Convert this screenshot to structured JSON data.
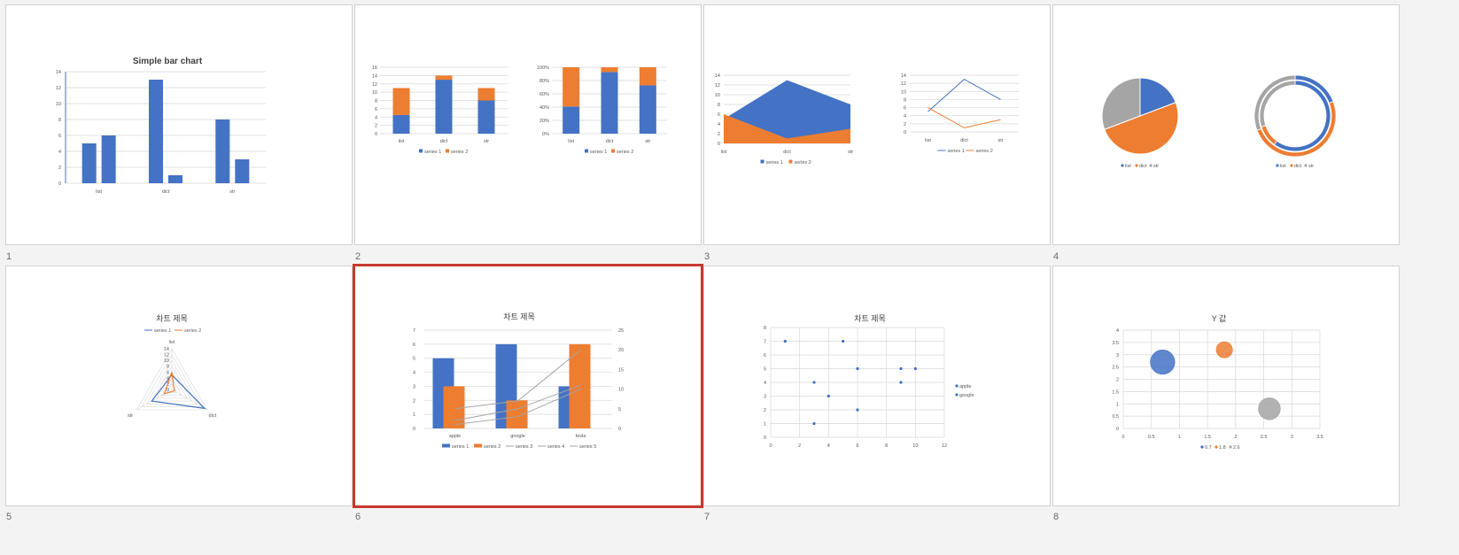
{
  "colors": {
    "blue": "#4472c4",
    "orange": "#ed7d31",
    "gray": "#a5a5a5",
    "selection": "#c8382e"
  },
  "slides": [
    {
      "number": "1",
      "chart_data": {
        "type": "bar",
        "title": "Simple bar chart",
        "categories": [
          "list",
          "dict",
          "str"
        ],
        "series": [
          {
            "values": [
              5,
              13,
              8
            ]
          },
          {
            "values": [
              6,
              1,
              3
            ]
          }
        ],
        "ylim": [
          0,
          14
        ],
        "yticks": [
          "0",
          "2",
          "4",
          "6",
          "8",
          "10",
          "12",
          "14"
        ]
      }
    },
    {
      "number": "2",
      "chart_data": [
        {
          "type": "bar",
          "stacked": true,
          "categories": [
            "list",
            "dict",
            "str"
          ],
          "series": [
            {
              "name": "series 1",
              "values": [
                4.5,
                13,
                8
              ]
            },
            {
              "name": "series 2",
              "values": [
                6.5,
                1,
                3
              ]
            }
          ],
          "ylim": [
            0,
            16
          ],
          "yticks": [
            "0",
            "2",
            "4",
            "6",
            "8",
            "10",
            "12",
            "14",
            "16"
          ]
        },
        {
          "type": "bar",
          "stacked": "percent",
          "categories": [
            "list",
            "dict",
            "str"
          ],
          "series": [
            {
              "name": "series 1",
              "values": [
                4.5,
                13,
                8
              ]
            },
            {
              "name": "series 2",
              "values": [
                6.5,
                1,
                3
              ]
            }
          ],
          "ylim": [
            0,
            100
          ],
          "yticks": [
            "0%",
            "20%",
            "40%",
            "60%",
            "80%",
            "100%"
          ]
        }
      ]
    },
    {
      "number": "3",
      "chart_data": [
        {
          "type": "area",
          "categories": [
            "list",
            "dict",
            "str"
          ],
          "series": [
            {
              "name": "series 1",
              "values": [
                5,
                13,
                8
              ]
            },
            {
              "name": "series 2",
              "values": [
                6,
                1,
                3
              ]
            }
          ],
          "ylim": [
            0,
            14
          ],
          "yticks": [
            "0",
            "2",
            "4",
            "6",
            "8",
            "10",
            "12",
            "14"
          ]
        },
        {
          "type": "line",
          "categories": [
            "list",
            "dict",
            "str"
          ],
          "series": [
            {
              "name": "series 1",
              "values": [
                5,
                13,
                8
              ]
            },
            {
              "name": "series 2",
              "values": [
                6,
                1,
                3
              ]
            }
          ],
          "ylim": [
            0,
            14
          ],
          "yticks": [
            "0",
            "2",
            "4",
            "6",
            "8",
            "10",
            "12",
            "14"
          ]
        }
      ]
    },
    {
      "number": "4",
      "chart_data": [
        {
          "type": "pie",
          "categories": [
            "list",
            "dict",
            "str"
          ],
          "values": [
            5,
            13,
            8
          ]
        },
        {
          "type": "pie",
          "donut": true,
          "categories": [
            "list",
            "dict",
            "str"
          ],
          "series": [
            {
              "values": [
                5,
                13,
                8
              ]
            },
            {
              "values": [
                6,
                1,
                3
              ]
            }
          ]
        }
      ]
    },
    {
      "number": "5",
      "chart_data": {
        "type": "radar",
        "title": "차트 제목",
        "categories": [
          "list",
          "dict",
          "str"
        ],
        "series": [
          {
            "name": "series 1",
            "values": [
              5,
              13,
              8
            ]
          },
          {
            "name": "series 2",
            "values": [
              6,
              1,
              3
            ]
          }
        ],
        "ylim": [
          0,
          14
        ],
        "rticks": [
          "0",
          "2",
          "4",
          "6",
          "8",
          "10",
          "12",
          "14"
        ]
      }
    },
    {
      "number": "6",
      "selected": true,
      "chart_data": {
        "type": "bar",
        "title": "차트 제목",
        "categories": [
          "apple",
          "google",
          "tesla"
        ],
        "series": [
          {
            "name": "series 1",
            "type": "bar",
            "axis": "left",
            "values": [
              5,
              6,
              3
            ]
          },
          {
            "name": "series 2",
            "type": "bar",
            "axis": "left",
            "values": [
              3,
              2,
              6
            ]
          },
          {
            "name": "series 3",
            "type": "line",
            "axis": "right",
            "values": [
              5,
              7,
              20
            ]
          },
          {
            "name": "series 4",
            "type": "line",
            "axis": "right",
            "values": [
              2,
              5,
              11
            ]
          },
          {
            "name": "series 5",
            "type": "line",
            "axis": "right",
            "values": [
              1,
              3,
              10
            ]
          }
        ],
        "ylim": [
          0,
          7
        ],
        "yticks": [
          "0",
          "1",
          "2",
          "3",
          "4",
          "5",
          "6",
          "7"
        ],
        "y2lim": [
          0,
          25
        ],
        "y2ticks": [
          "0",
          "5",
          "10",
          "15",
          "20",
          "25"
        ]
      }
    },
    {
      "number": "7",
      "chart_data": {
        "type": "scatter",
        "title": "차트 제목",
        "series": [
          {
            "name": "apple",
            "points": [
              [
                1,
                7
              ],
              [
                5,
                7
              ],
              [
                6,
                5
              ],
              [
                9,
                5
              ],
              [
                10,
                5
              ],
              [
                3,
                4
              ],
              [
                9,
                4
              ],
              [
                4,
                3
              ],
              [
                6,
                2
              ],
              [
                3,
                1
              ]
            ]
          },
          {
            "name": "google",
            "points": []
          }
        ],
        "xlim": [
          0,
          12
        ],
        "ylim": [
          0,
          8
        ],
        "xticks": [
          "0",
          "2",
          "4",
          "6",
          "8",
          "10",
          "12"
        ],
        "yticks": [
          "0",
          "1",
          "2",
          "3",
          "4",
          "5",
          "6",
          "7",
          "8"
        ]
      }
    },
    {
      "number": "8",
      "chart_data": {
        "type": "scatter",
        "bubble": true,
        "title": "Y 값",
        "series": [
          {
            "name": "0.7",
            "points": [
              [
                0.7,
                2.7,
                3
              ]
            ]
          },
          {
            "name": "1.8",
            "points": [
              [
                1.8,
                3.2,
                2
              ]
            ]
          },
          {
            "name": "2.6",
            "points": [
              [
                2.6,
                0.8,
                2.7
              ]
            ]
          }
        ],
        "xlim": [
          0,
          3.5
        ],
        "ylim": [
          0,
          4
        ],
        "xticks": [
          "0",
          "0.5",
          "1",
          "1.5",
          "2",
          "2.5",
          "3",
          "3.5"
        ],
        "yticks": [
          "0",
          "0.5",
          "1",
          "1.5",
          "2",
          "2.5",
          "3",
          "3.5",
          "4"
        ]
      }
    }
  ]
}
